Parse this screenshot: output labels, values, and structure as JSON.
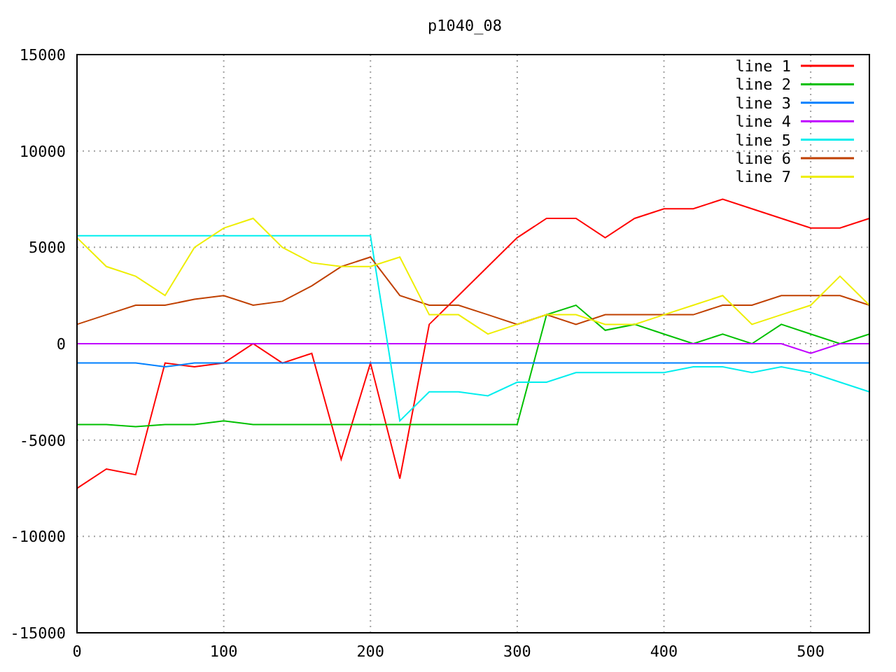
{
  "chart": {
    "chart_data": {
      "type": "line",
      "title": "p1040_08",
      "grid": true,
      "legend": true,
      "x": [
        0,
        20,
        40,
        60,
        80,
        100,
        120,
        140,
        160,
        180,
        200,
        220,
        240,
        260,
        280,
        300,
        320,
        340,
        360,
        380,
        400,
        420,
        440,
        460,
        480,
        500,
        520,
        540
      ],
      "xlim": [
        0,
        540
      ],
      "ylim": [
        -15000,
        15000
      ],
      "xticks": [
        0,
        100,
        200,
        300,
        400,
        500
      ],
      "yticks": [
        -15000,
        -10000,
        -5000,
        0,
        5000,
        10000,
        15000
      ],
      "series": [
        {
          "name": "line 1",
          "color": "#ff0000",
          "values": [
            -7500,
            -6500,
            -6800,
            -1000,
            -1200,
            -1000,
            0,
            -1000,
            -500,
            -6000,
            -1000,
            -7000,
            1000,
            2500,
            4000,
            5500,
            6500,
            6500,
            5500,
            6500,
            7000,
            7000,
            7500,
            7000,
            6500,
            6000,
            6000,
            6500
          ]
        },
        {
          "name": "line 2",
          "color": "#00c000",
          "values": [
            -4200,
            -4200,
            -4300,
            -4200,
            -4200,
            -4000,
            -4200,
            -4200,
            -4200,
            -4200,
            -4200,
            -4200,
            -4200,
            -4200,
            -4200,
            -4200,
            1500,
            2000,
            700,
            1000,
            500,
            0,
            500,
            0,
            1000,
            500,
            0,
            500
          ]
        },
        {
          "name": "line 3",
          "color": "#0080ff",
          "values": [
            -1000,
            -1000,
            -1000,
            -1200,
            -1000,
            -1000,
            -1000,
            -1000,
            -1000,
            -1000,
            -1000,
            -1000,
            -1000,
            -1000,
            -1000,
            -1000,
            -1000,
            -1000,
            -1000,
            -1000,
            -1000,
            -1000,
            -1000,
            -1000,
            -1000,
            -1000,
            -1000,
            -1000
          ]
        },
        {
          "name": "line 4",
          "color": "#c000ff",
          "values": [
            0,
            0,
            0,
            0,
            0,
            0,
            0,
            0,
            0,
            0,
            0,
            0,
            0,
            0,
            0,
            0,
            0,
            0,
            0,
            0,
            0,
            0,
            0,
            0,
            0,
            -500,
            0,
            0
          ]
        },
        {
          "name": "line 5",
          "color": "#00eeee",
          "values": [
            5600,
            5600,
            5600,
            5600,
            5600,
            5600,
            5600,
            5600,
            5600,
            5600,
            5600,
            -4000,
            -2500,
            -2500,
            -2700,
            -2000,
            -2000,
            -1500,
            -1500,
            -1500,
            -1500,
            -1200,
            -1200,
            -1500,
            -1200,
            -1500,
            -2000,
            -2500
          ]
        },
        {
          "name": "line 6",
          "color": "#c04000",
          "values": [
            1000,
            1500,
            2000,
            2000,
            2300,
            2500,
            2000,
            2200,
            3000,
            4000,
            4500,
            2500,
            2000,
            2000,
            1500,
            1000,
            1500,
            1000,
            1500,
            1500,
            1500,
            1500,
            2000,
            2000,
            2500,
            2500,
            2500,
            2000
          ]
        },
        {
          "name": "line 7",
          "color": "#eeee00",
          "values": [
            5500,
            4000,
            3500,
            2500,
            5000,
            6000,
            6500,
            5000,
            4200,
            4000,
            4000,
            4500,
            1500,
            1500,
            500,
            1000,
            1500,
            1500,
            1000,
            1000,
            1500,
            2000,
            2500,
            1000,
            1500,
            2000,
            3500,
            2000
          ]
        }
      ]
    }
  }
}
